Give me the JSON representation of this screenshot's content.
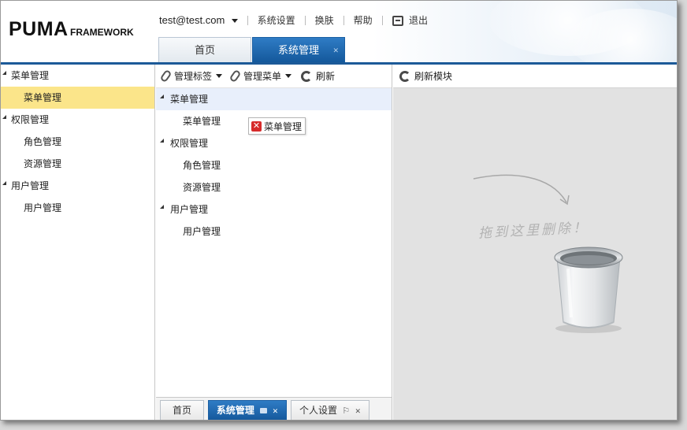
{
  "app": {
    "logo": "PUMA",
    "logo_sub": "FRAMEWORK"
  },
  "top_nav": {
    "user": "test@test.com",
    "links": [
      "系统设置",
      "换肤",
      "帮助"
    ],
    "logout": "退出"
  },
  "main_tabs": [
    {
      "label": "首页",
      "active": false
    },
    {
      "label": "系统管理",
      "active": true
    }
  ],
  "sidebar": {
    "items": [
      {
        "label": "菜单管理",
        "type": "group"
      },
      {
        "label": "菜单管理",
        "type": "leaf",
        "selected": true
      },
      {
        "label": "权限管理",
        "type": "group"
      },
      {
        "label": "角色管理",
        "type": "leaf"
      },
      {
        "label": "资源管理",
        "type": "leaf"
      },
      {
        "label": "用户管理",
        "type": "group"
      },
      {
        "label": "用户管理",
        "type": "leaf"
      }
    ]
  },
  "middle": {
    "toolbar": {
      "manage_tags": "管理标签",
      "manage_menu": "管理菜单",
      "refresh": "刷新"
    },
    "tree": [
      {
        "label": "菜单管理",
        "type": "group",
        "highlighted": true
      },
      {
        "label": "菜单管理",
        "type": "leaf"
      },
      {
        "label": "权限管理",
        "type": "group"
      },
      {
        "label": "角色管理",
        "type": "leaf"
      },
      {
        "label": "资源管理",
        "type": "leaf"
      },
      {
        "label": "用户管理",
        "type": "group"
      },
      {
        "label": "用户管理",
        "type": "leaf"
      }
    ],
    "drag_tag": "菜单管理",
    "bottom_tabs": [
      {
        "label": "首页",
        "active": false
      },
      {
        "label": "系统管理",
        "active": true
      },
      {
        "label": "个人设置",
        "active": false
      }
    ]
  },
  "right": {
    "toolbar": {
      "refresh_module": "刷新模块"
    },
    "drop_hint": "拖到这里删除！"
  },
  "colors": {
    "accent": "#1c5a98",
    "selected": "#fbe58a",
    "tab_active": "#2470b8"
  }
}
